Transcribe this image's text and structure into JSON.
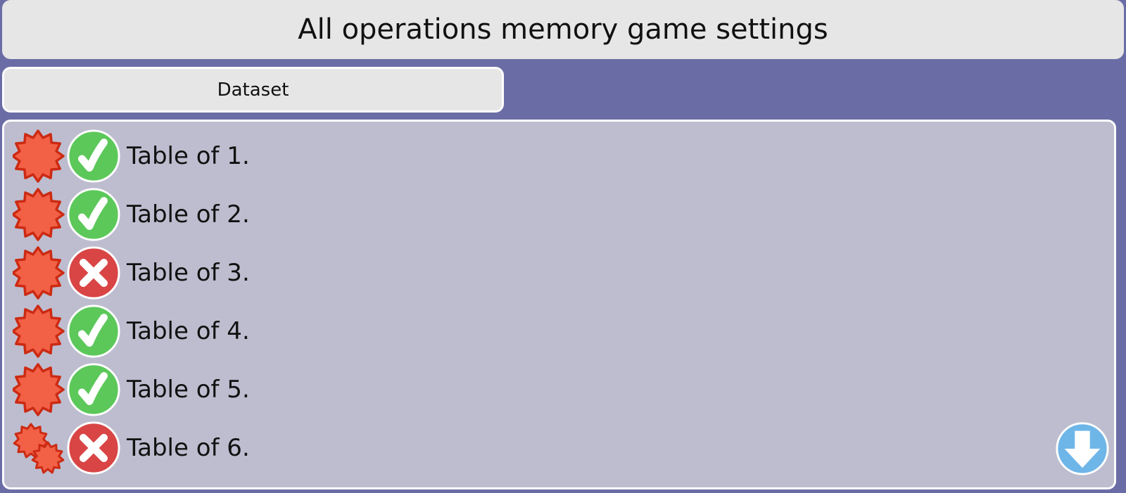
{
  "header": {
    "title": "All operations memory game settings"
  },
  "tabs": [
    {
      "label": "Dataset"
    }
  ],
  "items": [
    {
      "label": "Table of 1.",
      "enabled": true,
      "badge_icon": "star-burst-icon"
    },
    {
      "label": "Table of 2.",
      "enabled": true,
      "badge_icon": "star-burst-icon"
    },
    {
      "label": "Table of 3.",
      "enabled": false,
      "badge_icon": "star-burst-icon"
    },
    {
      "label": "Table of 4.",
      "enabled": true,
      "badge_icon": "star-burst-icon"
    },
    {
      "label": "Table of 5.",
      "enabled": true,
      "badge_icon": "star-burst-icon"
    },
    {
      "label": "Table of 6.",
      "enabled": false,
      "badge_icon": "double-star-burst-icon"
    }
  ],
  "scroll_button_icon": "arrow-down-icon",
  "colors": {
    "background": "#6a6da5",
    "panel": "#bdbdcf",
    "header": "#e6e6e6",
    "check_green": "#5cc85a",
    "cross_red": "#d94545",
    "star_fill": "#f26046",
    "star_stroke": "#cc2a12",
    "scroll_blue": "#6fb6e8"
  }
}
